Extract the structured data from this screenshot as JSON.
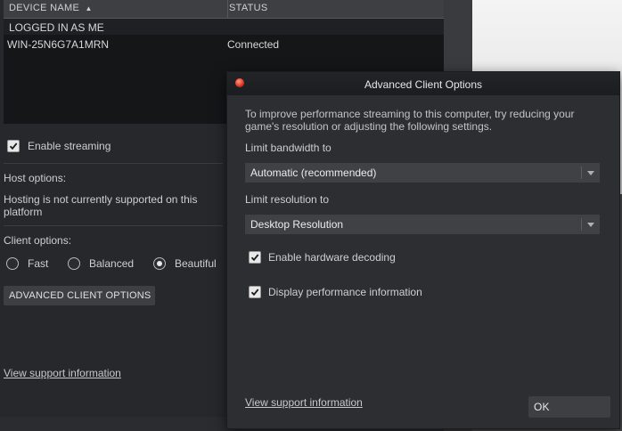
{
  "table": {
    "col_device": "DEVICE NAME",
    "col_status": "STATUS",
    "group": "LOGGED IN AS ME",
    "rows": [
      {
        "device": "WIN-25N6G7A1MRN",
        "status": "Connected"
      }
    ]
  },
  "streaming": {
    "enable_label": "Enable streaming",
    "enabled": true
  },
  "host": {
    "label": "Host options:",
    "note": "Hosting is not currently supported on this platform"
  },
  "client": {
    "label": "Client options:",
    "options": [
      "Fast",
      "Balanced",
      "Beautiful"
    ],
    "selected": "Beautiful",
    "advanced_button": "ADVANCED CLIENT OPTIONS"
  },
  "panel_support_link": "View support information",
  "dialog": {
    "title": "Advanced Client Options",
    "description": "To improve performance streaming to this computer, try reducing your game's resolution or adjusting the following settings.",
    "bandwidth_label": "Limit bandwidth to",
    "bandwidth_value": "Automatic (recommended)",
    "resolution_label": "Limit resolution to",
    "resolution_value": "Desktop Resolution",
    "hw_decoding_label": "Enable hardware decoding",
    "hw_decoding": true,
    "perf_info_label": "Display performance information",
    "perf_info": true,
    "support_link": "View support information",
    "ok_label": "OK"
  },
  "colors": {
    "close_button": "#e0301e",
    "panel_bg": "#26282c",
    "dialog_bg": "#2c2e32"
  }
}
